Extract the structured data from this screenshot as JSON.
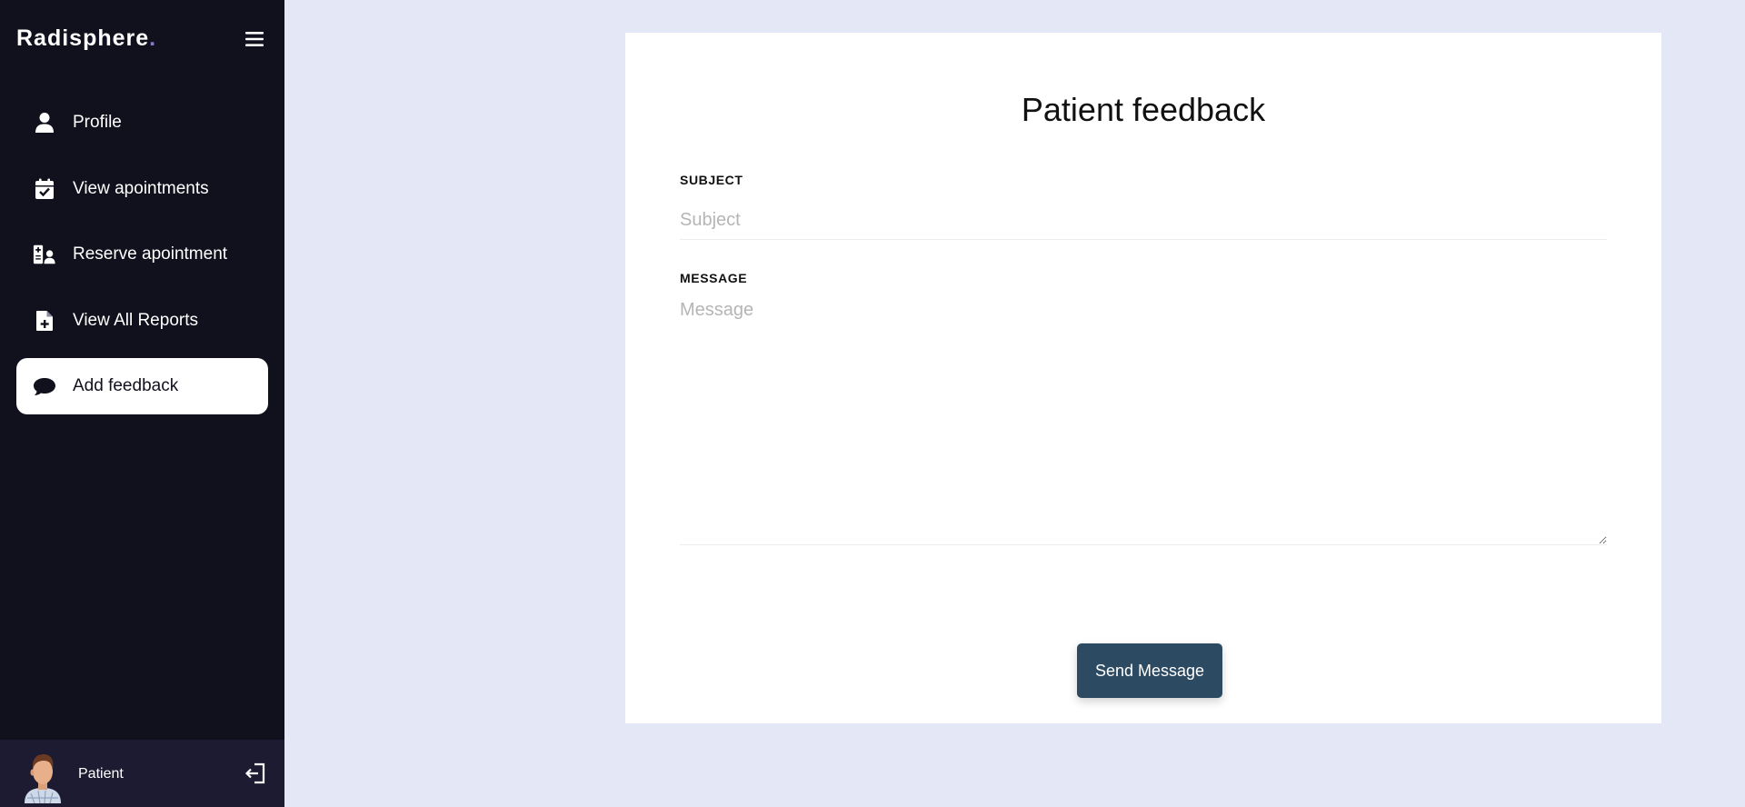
{
  "sidebar": {
    "brand": "Radisphere",
    "brand_dot": ".",
    "items": [
      {
        "label": "Profile",
        "icon": "user-icon"
      },
      {
        "label": "View apointments",
        "icon": "calendar-check-icon"
      },
      {
        "label": "Reserve apointment",
        "icon": "doctor-reserve-icon"
      },
      {
        "label": "View All Reports",
        "icon": "file-medical-icon"
      },
      {
        "label": "Add feedback",
        "icon": "comment-icon",
        "active": true
      }
    ],
    "profile": {
      "name": "Patient"
    }
  },
  "form": {
    "title": "Patient feedback",
    "subject_label": "SUBJECT",
    "subject_placeholder": "Subject",
    "message_label": "MESSAGE",
    "message_placeholder": "Message",
    "send_label": "Send Message"
  },
  "colors": {
    "sidebar_bg": "#11101d",
    "profile_bg": "#1d1b31",
    "page_bg": "#e4e7f5",
    "button_bg": "#2c4a61"
  }
}
